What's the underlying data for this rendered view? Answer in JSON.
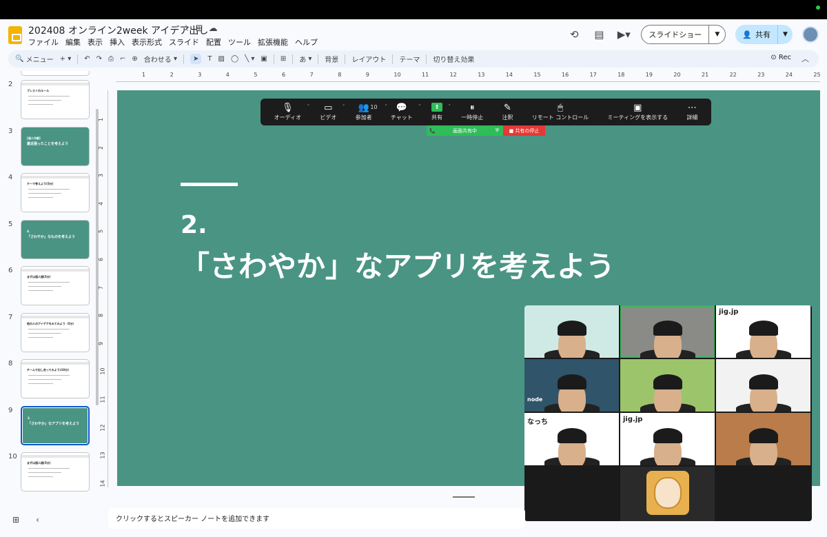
{
  "document": {
    "title": "202408 オンライン2week アイデア出し",
    "menu": [
      "ファイル",
      "編集",
      "表示",
      "挿入",
      "表示形式",
      "スライド",
      "配置",
      "ツール",
      "拡張機能",
      "ヘルプ"
    ]
  },
  "header": {
    "slideshow_label": "スライドショー",
    "share_label": "共有"
  },
  "toolbar": {
    "menu_search": "メニュー",
    "zoom_label": "合わせる",
    "ime_label": "あ",
    "background_label": "背景",
    "layout_label": "レイアウト",
    "theme_label": "テーマ",
    "transition_label": "切り替え効果",
    "rec_label": "Rec"
  },
  "ruler": {
    "horizontal": [
      "1",
      "2",
      "3",
      "4",
      "5",
      "6",
      "7",
      "8",
      "9",
      "10",
      "11",
      "12",
      "13",
      "14",
      "15",
      "16",
      "17",
      "18",
      "19",
      "20",
      "21",
      "22",
      "23",
      "24",
      "25"
    ],
    "vertical": [
      "1",
      "2",
      "3",
      "4",
      "5",
      "6",
      "7",
      "8",
      "9",
      "10",
      "11",
      "12",
      "13",
      "14"
    ]
  },
  "filmstrip": {
    "slides": [
      {
        "number": "2",
        "title": "ブレストのルール",
        "style": "white"
      },
      {
        "number": "3",
        "title": "最近困ったことを考えよう",
        "sub": "[個人作業]",
        "style": "green"
      },
      {
        "number": "4",
        "title": "テーマ考えよう(5分)",
        "style": "white"
      },
      {
        "number": "5",
        "title": "「さわやか」なものを考えよう",
        "sub": "4.",
        "style": "green"
      },
      {
        "number": "6",
        "title": "まずは個人個(5分)",
        "style": "white"
      },
      {
        "number": "7",
        "title": "他の人のアイデアをみてみよう（5分）",
        "style": "white"
      },
      {
        "number": "8",
        "title": "チームで出し合ってみよう(10分)",
        "style": "white"
      },
      {
        "number": "9",
        "title": "「さわやか」なアプリを考えよう",
        "sub": "2.",
        "style": "green",
        "active": true
      },
      {
        "number": "10",
        "title": "まずは個人個(5分)",
        "style": "white"
      }
    ]
  },
  "slide": {
    "number_text": "2.",
    "heading": "「さわやか」なアプリを考えよう"
  },
  "zoom": {
    "controls": [
      {
        "label": "オーディオ",
        "icon": "microphone-icon",
        "glyph": "🎙"
      },
      {
        "label": "ビデオ",
        "icon": "video-icon",
        "glyph": "▭"
      },
      {
        "label": "参加者",
        "icon": "participants-icon",
        "glyph": "👥",
        "count": "10"
      },
      {
        "label": "チャット",
        "icon": "chat-icon",
        "glyph": "💬"
      },
      {
        "label": "共有",
        "icon": "share-screen-icon",
        "glyph": "⬆"
      },
      {
        "label": "一時停止",
        "icon": "pause-icon",
        "glyph": "⏸"
      },
      {
        "label": "注釈",
        "icon": "annotate-icon",
        "glyph": "✎"
      },
      {
        "label": "リモート コントロール",
        "icon": "mouse-icon",
        "glyph": "🖱"
      },
      {
        "label": "ミーティングを表示する",
        "icon": "window-icon",
        "glyph": "▣"
      },
      {
        "label": "詳細",
        "icon": "more-icon",
        "glyph": "⋯"
      }
    ],
    "sharing_label": "画面共有中",
    "stop_label": "共有の停止",
    "tiles": [
      {
        "bg": "#cfe9e4",
        "label": ""
      },
      {
        "bg": "#8a8a86",
        "label": "",
        "active": true
      },
      {
        "bg": "#ffffff",
        "label": "jig.jp"
      },
      {
        "bg": "#30546a",
        "label": "node"
      },
      {
        "bg": "#9cc46a",
        "label": ""
      },
      {
        "bg": "#f2f2f2",
        "label": ""
      },
      {
        "bg": "#ffffff",
        "label": "なっち"
      },
      {
        "bg": "#ffffff",
        "label": "jig.jp"
      },
      {
        "bg": "#b97c4a",
        "label": ""
      }
    ]
  },
  "notes": {
    "placeholder": "クリックするとスピーカー ノートを追加できます"
  }
}
